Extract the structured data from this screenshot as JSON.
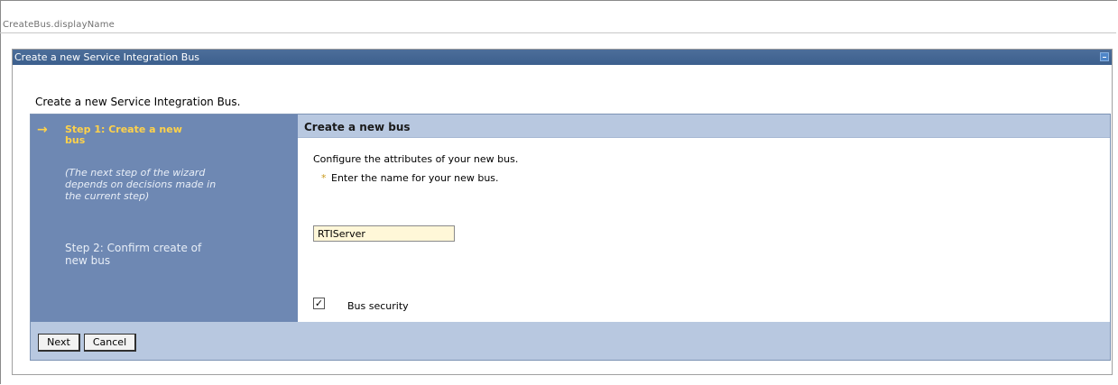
{
  "page": {
    "header_title": "CreateBus.displayName"
  },
  "portlet": {
    "title": "Create a new Service Integration Bus",
    "minimize_icon": "minimize-icon"
  },
  "wizard": {
    "intro": "Create a new Service Integration Bus.",
    "steps": {
      "current_arrow": "→",
      "step1": "Step 1: Create a new bus",
      "note": "(The next step of the wizard depends on decisions made in the current step)",
      "step2": "Step 2: Confirm create of new bus"
    },
    "content": {
      "title": "Create a new bus",
      "configure_text": "Configure the attributes of your new bus.",
      "required_marker": "*",
      "name_label": "Enter the name for your new bus.",
      "name_value": "RTIServer",
      "bus_security_checked": true,
      "bus_security_mark": "✓",
      "bus_security_label": "Bus security"
    },
    "buttons": {
      "next": "Next",
      "cancel": "Cancel"
    }
  },
  "colors": {
    "titlebar": "#3c5f8d",
    "steps_panel": "#6e88b3",
    "current_step": "#ffd24a",
    "wizard_bg": "#b8c8e0",
    "input_bg": "#fff7d8"
  }
}
